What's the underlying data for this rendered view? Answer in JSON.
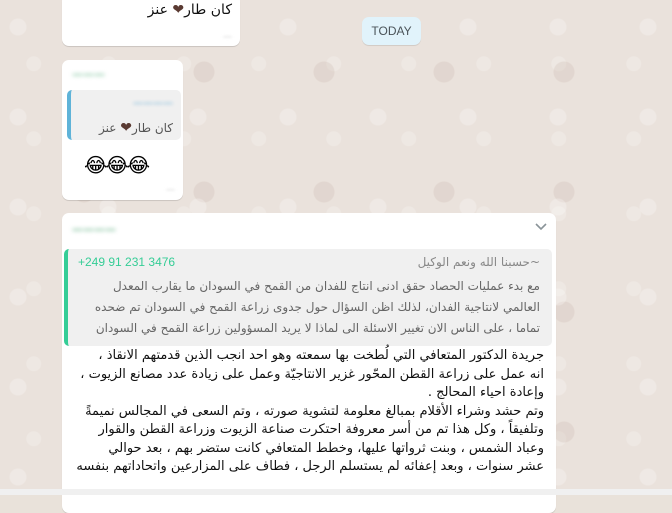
{
  "date_chip": "TODAY",
  "messages": {
    "m1": {
      "text": "كان طار",
      "suffix": " عنز",
      "time": ""
    },
    "m2": {
      "sender": "",
      "quoted_text": "كان طار",
      "quoted_suffix": " عنز",
      "emojis": "😂😂😂",
      "time": ""
    },
    "m3": {
      "sender": "",
      "quote": {
        "phone": "+249 91 231 3476",
        "pushname": "~حسبنا الله ونعم الوكيل",
        "lines": [
          "مع بدء عمليات الحصاد حقق ادنى انتاج للفدان من القمح في السودان ما يقارب المعدل",
          "العالمي لانتاجية الفدان، لذلك اظن السؤال حول جدوى زراعة القمح في السودان تم ضحده",
          "تماما ، على الناس الان تغيير الاسئلة الى لماذا لا يريد المسؤولين زراعة القمح في السودان"
        ]
      },
      "body_lines": [
        "جريدة الدكتور المتعافي التي لُطخت بها سمعته وهو احد انجب الذين قدمتهم الانقاذ ،",
        "انه عمل على زراعة القطن المحّور غزير الانتاجيّة وعمل على زيادة عدد مصانع الزيوت ،",
        "وإعادة احياء المحالج .",
        "وتم حشد وشراء الأقلام بمبالغ معلومة لتشوية صورته ، وتم السعى في المجالس نميمةً",
        "وتلفيقاً ، وكل هذا تم من أسر معروفة احتكرت صناعة الزيوت وزراعة القطن والقوار",
        "وعباد الشمس ، وبنت ثرواتها عليها، وخطط المتعافي كانت ستضر بهم ، بعد حوالي",
        "عشر سنوات ، وبعد إعفائه لم يستسلم الرجل ، فطاف على المزارعين واتحاداتهم بنفسه"
      ]
    }
  }
}
